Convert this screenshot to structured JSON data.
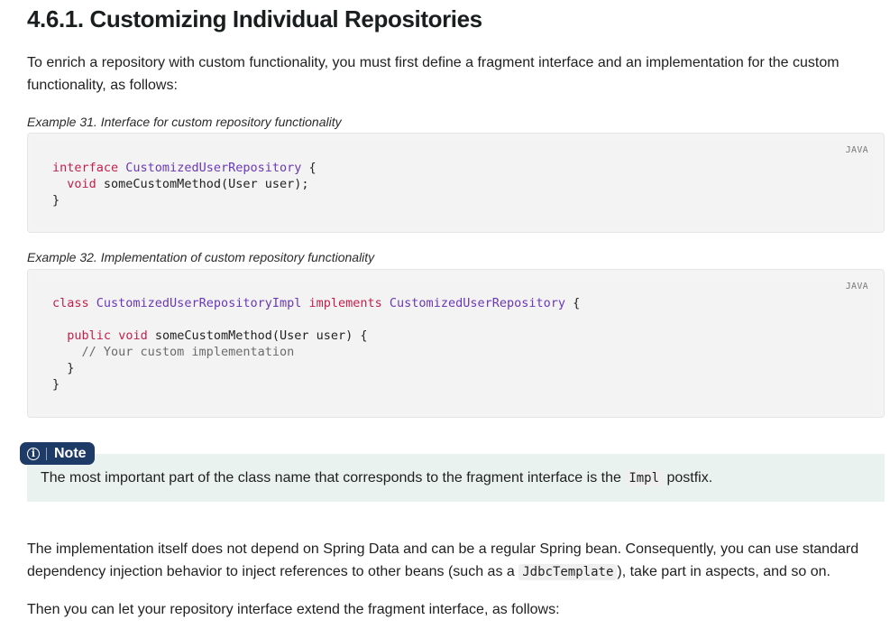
{
  "heading": "4.6.1. Customizing Individual Repositories",
  "intro": "To enrich a repository with custom functionality, you must first define a fragment interface and an implementation for the custom functionality, as follows:",
  "example31": {
    "caption": "Example 31. Interface for custom repository functionality",
    "lang": "JAVA",
    "code": [
      [
        [
          "kw",
          "interface"
        ],
        [
          "t",
          " "
        ],
        [
          "ty",
          "CustomizedUserRepository"
        ],
        [
          "t",
          " {"
        ]
      ],
      [
        [
          "t",
          "  "
        ],
        [
          "kw",
          "void"
        ],
        [
          "t",
          " someCustomMethod(User user);"
        ]
      ],
      [
        [
          "t",
          "}"
        ]
      ]
    ]
  },
  "example32": {
    "caption": "Example 32. Implementation of custom repository functionality",
    "lang": "JAVA",
    "code": [
      [
        [
          "kw",
          "class"
        ],
        [
          "t",
          " "
        ],
        [
          "ty",
          "CustomizedUserRepositoryImpl"
        ],
        [
          "t",
          " "
        ],
        [
          "kw",
          "implements"
        ],
        [
          "t",
          " "
        ],
        [
          "ty",
          "CustomizedUserRepository"
        ],
        [
          "t",
          " {"
        ]
      ],
      [
        [
          "t",
          ""
        ]
      ],
      [
        [
          "t",
          "  "
        ],
        [
          "kw",
          "public"
        ],
        [
          "t",
          " "
        ],
        [
          "kw",
          "void"
        ],
        [
          "t",
          " someCustomMethod(User user) {"
        ]
      ],
      [
        [
          "t",
          "    "
        ],
        [
          "cm",
          "// Your custom implementation"
        ]
      ],
      [
        [
          "t",
          "  }"
        ]
      ],
      [
        [
          "t",
          "}"
        ]
      ]
    ]
  },
  "note": {
    "label": "Note",
    "text_before": "The most important part of the class name that corresponds to the fragment interface is the ",
    "code": "Impl",
    "text_after": " postfix."
  },
  "para2": {
    "text_before": "The implementation itself does not depend on Spring Data and can be a regular Spring bean. Consequently, you can use standard dependency injection behavior to inject references to other beans (such as a ",
    "code": "JdbcTemplate",
    "text_after": "), take part in aspects, and so on."
  },
  "para3": "Then you can let your repository interface extend the fragment interface, as follows:"
}
